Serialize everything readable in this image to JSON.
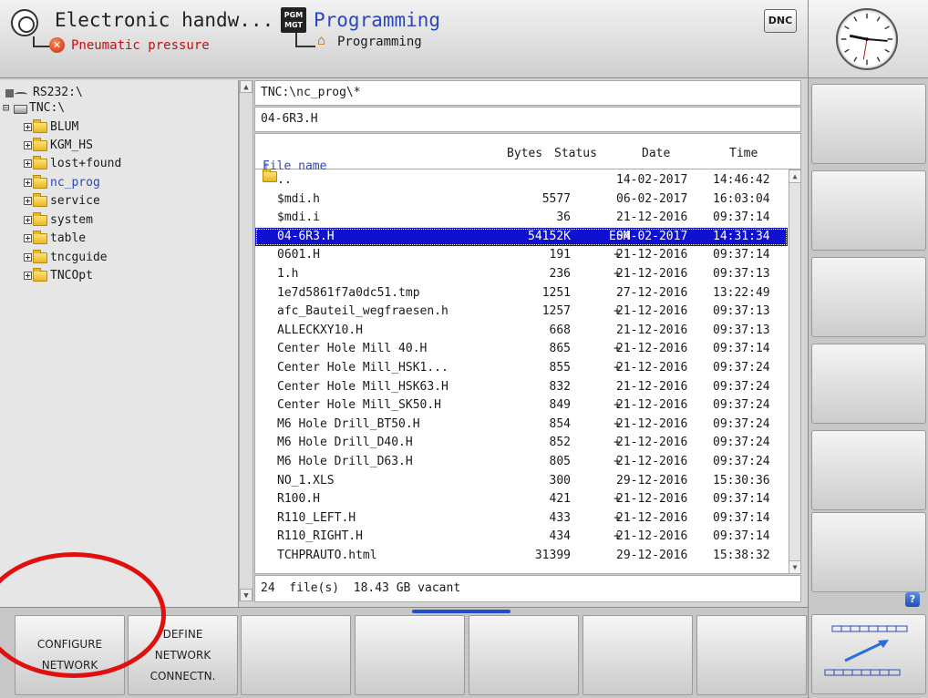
{
  "header": {
    "mode1_title": "Electronic handw...",
    "mode1_status": "Pneumatic pressure",
    "mode2_title": "Programming",
    "mode2_sub": "Programming",
    "pgm_icon_text": "PGM MGT",
    "dnc_label": "DNC"
  },
  "tree": {
    "items": [
      {
        "label": "RS232:\\"
      },
      {
        "label": "TNC:\\"
      },
      {
        "label": "BLUM"
      },
      {
        "label": "KGM_HS"
      },
      {
        "label": "lost+found"
      },
      {
        "label": "nc_prog"
      },
      {
        "label": "service"
      },
      {
        "label": "system"
      },
      {
        "label": "table"
      },
      {
        "label": "tncguide"
      },
      {
        "label": "TNCOpt"
      }
    ]
  },
  "file_browser": {
    "path": "TNC:\\nc_prog\\*",
    "selected_file": "04-6R3.H",
    "columns": {
      "name": "File name",
      "bytes": "Bytes",
      "status": "Status",
      "date": "Date",
      "time": "Time"
    },
    "files": [
      {
        "name": "..",
        "bytes": "",
        "status": "",
        "date": "14-02-2017",
        "time": "14:46:42"
      },
      {
        "name": "$mdi.h",
        "bytes": "5577",
        "status": "",
        "date": "06-02-2017",
        "time": "16:03:04"
      },
      {
        "name": "$mdi.i",
        "bytes": "36",
        "status": "",
        "date": "21-12-2016",
        "time": "09:37:14"
      },
      {
        "name": "04-6R3.H",
        "bytes": "54152K",
        "status": "ESM",
        "date": "04-02-2017",
        "time": "14:31:34"
      },
      {
        "name": "0601.H",
        "bytes": "191",
        "status": "+",
        "date": "21-12-2016",
        "time": "09:37:14"
      },
      {
        "name": "1.h",
        "bytes": "236",
        "status": "+",
        "date": "21-12-2016",
        "time": "09:37:13"
      },
      {
        "name": "1e7d5861f7a0dc51.tmp",
        "bytes": "1251",
        "status": "",
        "date": "27-12-2016",
        "time": "13:22:49"
      },
      {
        "name": "afc_Bauteil_wegfraesen.h",
        "bytes": "1257",
        "status": "+",
        "date": "21-12-2016",
        "time": "09:37:13"
      },
      {
        "name": "ALLECKXY10.H",
        "bytes": "668",
        "status": "",
        "date": "21-12-2016",
        "time": "09:37:13"
      },
      {
        "name": "Center Hole Mill 40.H",
        "bytes": "865",
        "status": "+",
        "date": "21-12-2016",
        "time": "09:37:14"
      },
      {
        "name": "Center Hole Mill_HSK1...",
        "bytes": "855",
        "status": "+",
        "date": "21-12-2016",
        "time": "09:37:24"
      },
      {
        "name": "Center Hole Mill_HSK63.H",
        "bytes": "832",
        "status": "",
        "date": "21-12-2016",
        "time": "09:37:24"
      },
      {
        "name": "Center Hole Mill_SK50.H",
        "bytes": "849",
        "status": "+",
        "date": "21-12-2016",
        "time": "09:37:24"
      },
      {
        "name": "M6 Hole Drill_BT50.H",
        "bytes": "854",
        "status": "+",
        "date": "21-12-2016",
        "time": "09:37:24"
      },
      {
        "name": "M6 Hole Drill_D40.H",
        "bytes": "852",
        "status": "+",
        "date": "21-12-2016",
        "time": "09:37:24"
      },
      {
        "name": "M6 Hole Drill_D63.H",
        "bytes": "805",
        "status": "+",
        "date": "21-12-2016",
        "time": "09:37:24"
      },
      {
        "name": "NO_1.XLS",
        "bytes": "300",
        "status": "",
        "date": "29-12-2016",
        "time": "15:30:36"
      },
      {
        "name": "R100.H",
        "bytes": "421",
        "status": "+",
        "date": "21-12-2016",
        "time": "09:37:14"
      },
      {
        "name": "R110_LEFT.H",
        "bytes": "433",
        "status": "+",
        "date": "21-12-2016",
        "time": "09:37:14"
      },
      {
        "name": "R110_RIGHT.H",
        "bytes": "434",
        "status": "+",
        "date": "21-12-2016",
        "time": "09:37:14"
      },
      {
        "name": "TCHPRAUTO.html",
        "bytes": "31399",
        "status": "",
        "date": "29-12-2016",
        "time": "15:38:32"
      }
    ],
    "status_bar": "24  file(s)  18.43 GB vacant"
  },
  "softkeys": [
    {
      "label": "CONFIGURE\nNETWORK"
    },
    {
      "label": "DEFINE\nNETWORK\nCONNECTN."
    },
    {
      "label": ""
    },
    {
      "label": ""
    },
    {
      "label": ""
    },
    {
      "label": ""
    },
    {
      "label": ""
    }
  ],
  "right_panel": {
    "help_label": "?"
  },
  "colors": {
    "selection": "#1010d0",
    "accent_blue": "#2c47b8",
    "annotation_red": "#e01010"
  }
}
